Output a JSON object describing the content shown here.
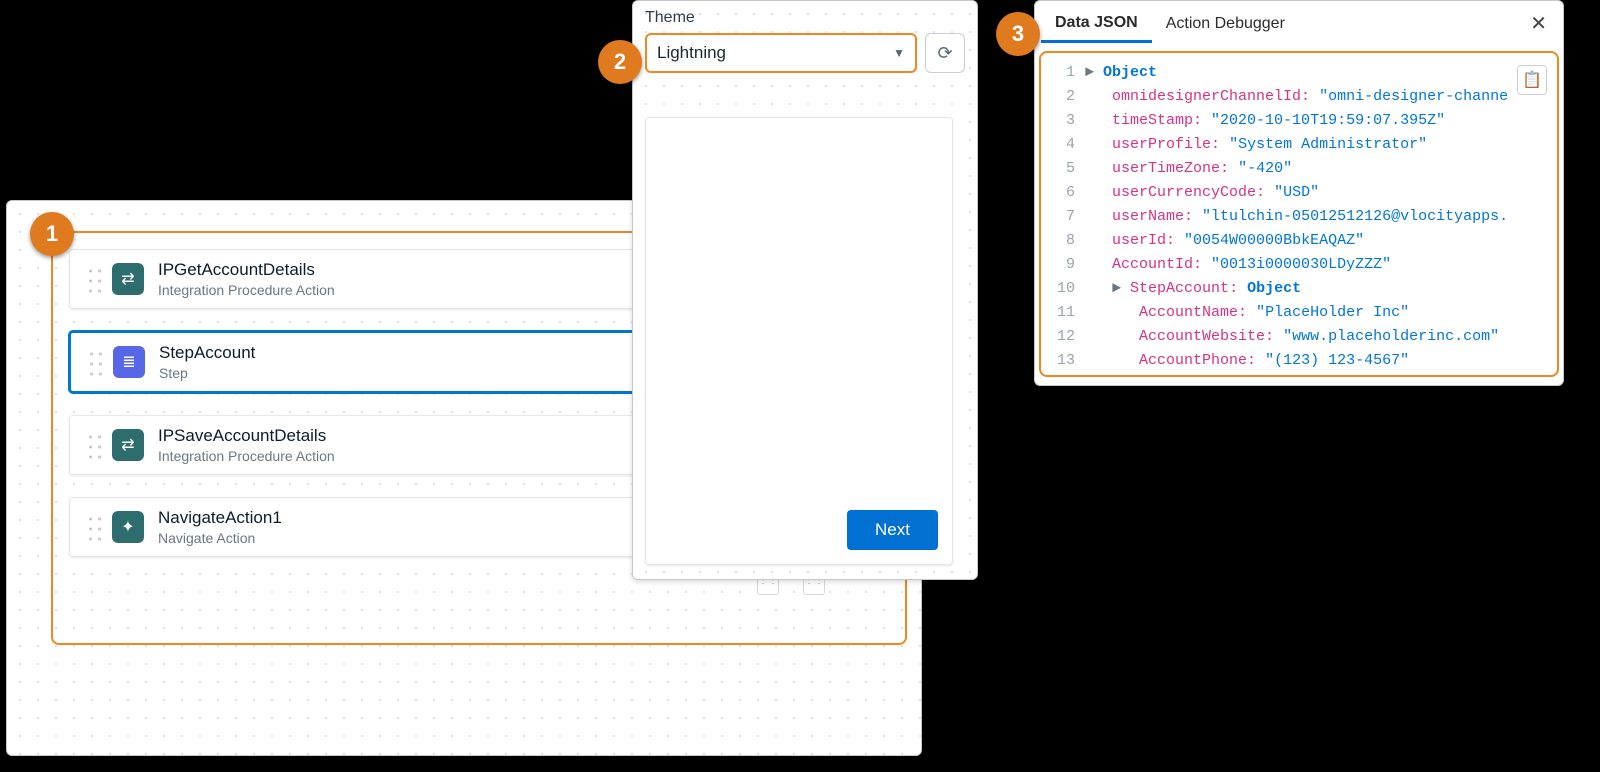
{
  "badges": {
    "one": "1",
    "two": "2",
    "three": "3"
  },
  "canvas": {
    "items": [
      {
        "title": "IPGetAccountDetails",
        "subtitle": "Integration Procedure Action",
        "iconColor": "teal",
        "iconGlyph": "⇄",
        "selected": false
      },
      {
        "title": "StepAccount",
        "subtitle": "Step",
        "iconColor": "indigo",
        "iconGlyph": "≣",
        "selected": true
      },
      {
        "title": "IPSaveAccountDetails",
        "subtitle": "Integration Procedure Action",
        "iconColor": "teal",
        "iconGlyph": "⇄",
        "selected": false
      },
      {
        "title": "NavigateAction1",
        "subtitle": "Navigate Action",
        "iconColor": "teal",
        "iconGlyph": "✦",
        "selected": false
      }
    ]
  },
  "preview": {
    "theme_label": "Theme",
    "theme_value": "Lightning",
    "next_label": "Next"
  },
  "debugger": {
    "tabs": {
      "data_json": "Data JSON",
      "action_debugger": "Action Debugger"
    },
    "rows": [
      {
        "ln": 1,
        "indent": 0,
        "arrow": true,
        "key": "",
        "value": "Object",
        "valueIsObj": true
      },
      {
        "ln": 2,
        "indent": 1,
        "arrow": false,
        "key": "omnidesignerChannelId",
        "value": "\"omni-designer-channe"
      },
      {
        "ln": 3,
        "indent": 1,
        "arrow": false,
        "key": "timeStamp",
        "value": "\"2020-10-10T19:59:07.395Z\""
      },
      {
        "ln": 4,
        "indent": 1,
        "arrow": false,
        "key": "userProfile",
        "value": "\"System Administrator\""
      },
      {
        "ln": 5,
        "indent": 1,
        "arrow": false,
        "key": "userTimeZone",
        "value": "\"-420\""
      },
      {
        "ln": 6,
        "indent": 1,
        "arrow": false,
        "key": "userCurrencyCode",
        "value": "\"USD\""
      },
      {
        "ln": 7,
        "indent": 1,
        "arrow": false,
        "key": "userName",
        "value": "\"ltulchin-05012512126@vlocityapps."
      },
      {
        "ln": 8,
        "indent": 1,
        "arrow": false,
        "key": "userId",
        "value": "\"0054W00000BbkEAQAZ\""
      },
      {
        "ln": 9,
        "indent": 1,
        "arrow": false,
        "key": "AccountId",
        "value": "\"0013i0000030LDyZZZ\""
      },
      {
        "ln": 10,
        "indent": 1,
        "arrow": true,
        "key": "StepAccount",
        "value": "Object",
        "valueIsObj": true
      },
      {
        "ln": 11,
        "indent": 2,
        "arrow": false,
        "key": "AccountName",
        "value": "\"PlaceHolder Inc\""
      },
      {
        "ln": 12,
        "indent": 2,
        "arrow": false,
        "key": "AccountWebsite",
        "value": "\"www.placeholderinc.com\""
      },
      {
        "ln": 13,
        "indent": 2,
        "arrow": false,
        "key": "AccountPhone",
        "value": "\"(123) 123-4567\""
      }
    ]
  }
}
